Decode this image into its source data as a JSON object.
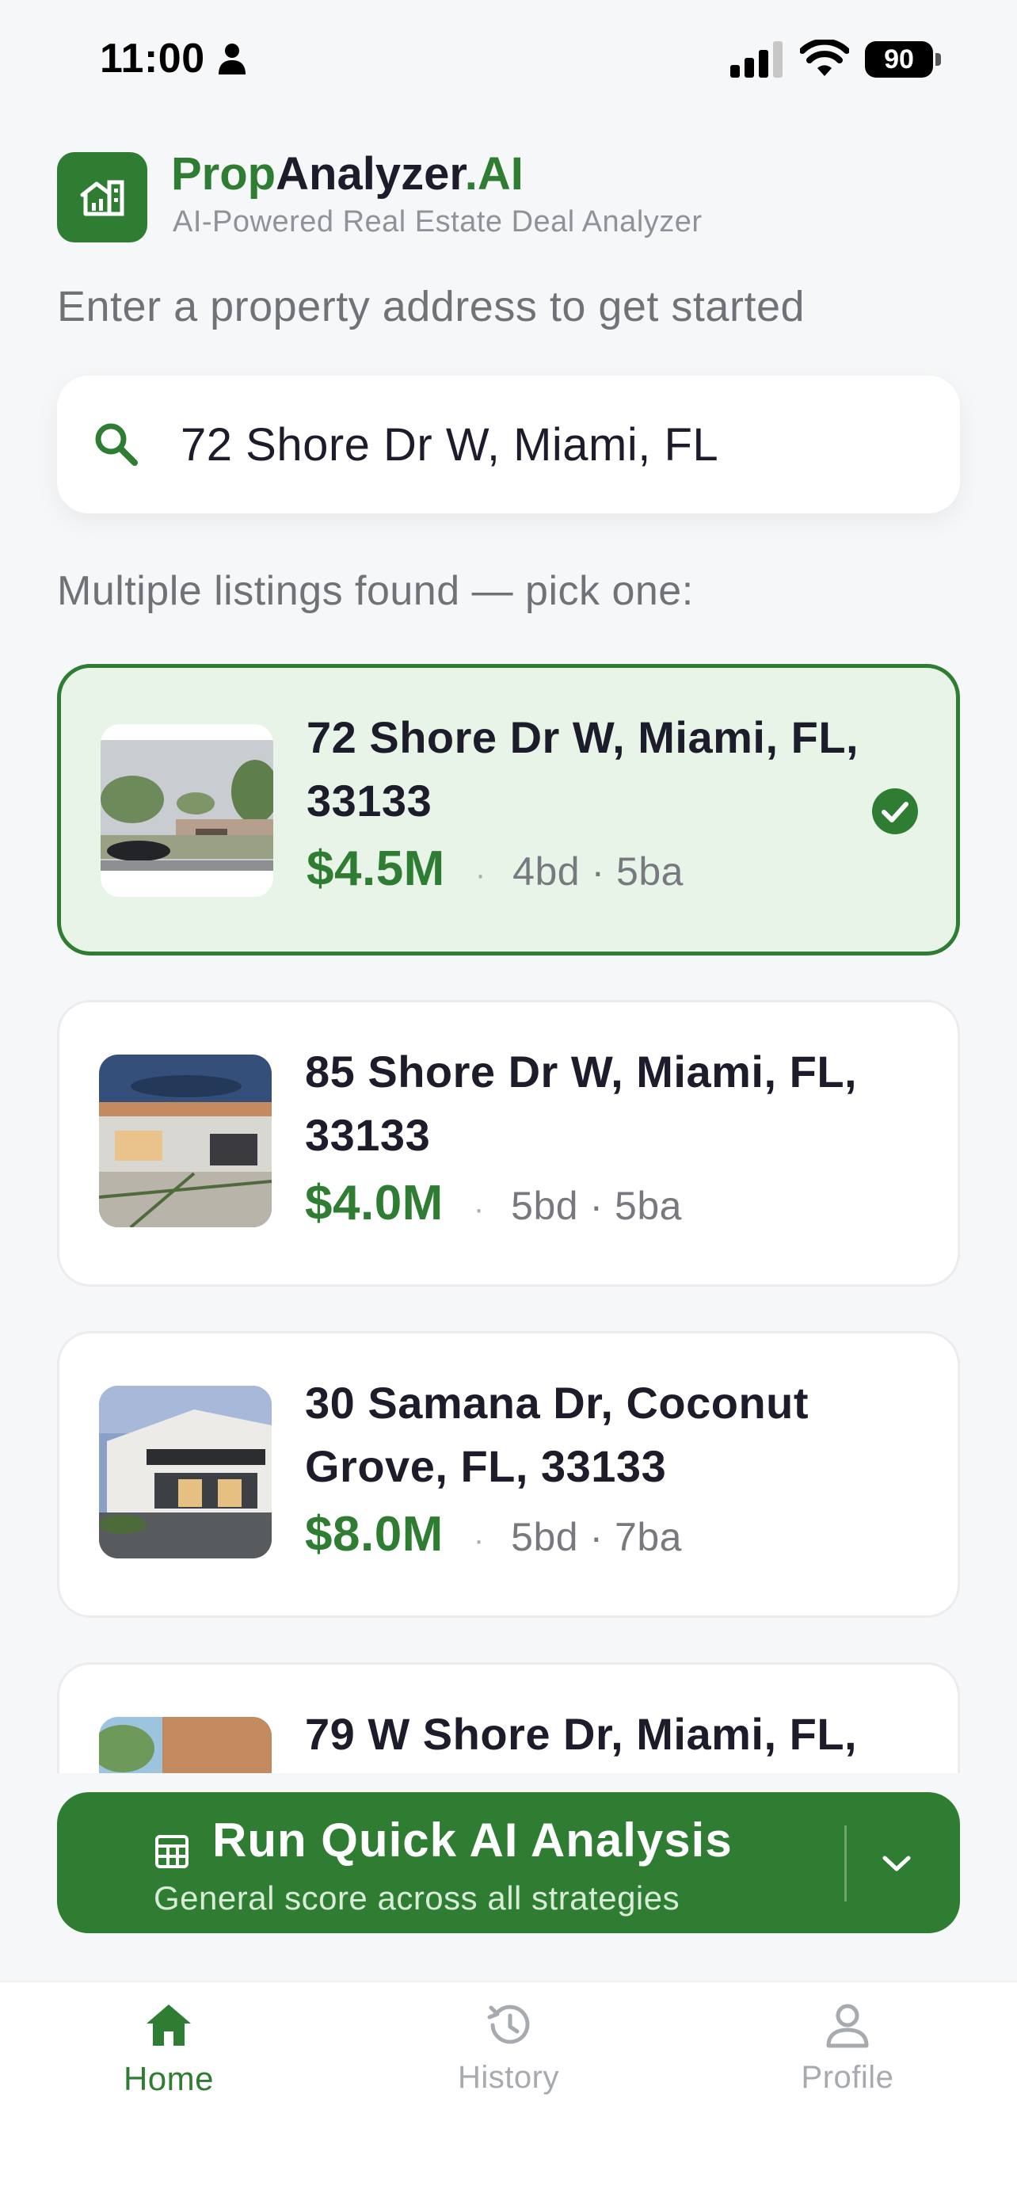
{
  "status_bar": {
    "time": "11:00",
    "battery": "90"
  },
  "header": {
    "brand_prop": "Prop",
    "brand_analyzer": "Analyzer",
    "brand_ai": ".AI",
    "tagline": "AI-Powered Real Estate Deal Analyzer"
  },
  "prompt": "Enter a property address to get started",
  "search": {
    "value": "72 Shore Dr W, Miami, FL"
  },
  "results_label": "Multiple listings found — pick one:",
  "listings": [
    {
      "address": "72 Shore Dr W, Miami, FL, 33133",
      "price": "$4.5M",
      "specs": "4bd · 5ba",
      "selected": true
    },
    {
      "address": "85 Shore Dr W, Miami, FL, 33133",
      "price": "$4.0M",
      "specs": "5bd · 5ba",
      "selected": false
    },
    {
      "address": "30 Samana Dr, Coconut Grove, FL, 33133",
      "price": "$8.0M",
      "specs": "5bd · 7ba",
      "selected": false
    },
    {
      "address": "79 W Shore Dr, Miami, FL,",
      "price": "",
      "specs": "",
      "selected": false
    }
  ],
  "dot_separator": "·",
  "analyze": {
    "title": "Run Quick AI Analysis",
    "subtitle": "General score across all strategies"
  },
  "tabs": [
    {
      "label": "Home",
      "icon": "home-icon",
      "active": true
    },
    {
      "label": "History",
      "icon": "history-icon",
      "active": false
    },
    {
      "label": "Profile",
      "icon": "profile-icon",
      "active": false
    }
  ],
  "colors": {
    "brand_green": "#2e7d32",
    "selected_card_bg": "#e8f4e8",
    "muted_text": "#6f7378"
  }
}
